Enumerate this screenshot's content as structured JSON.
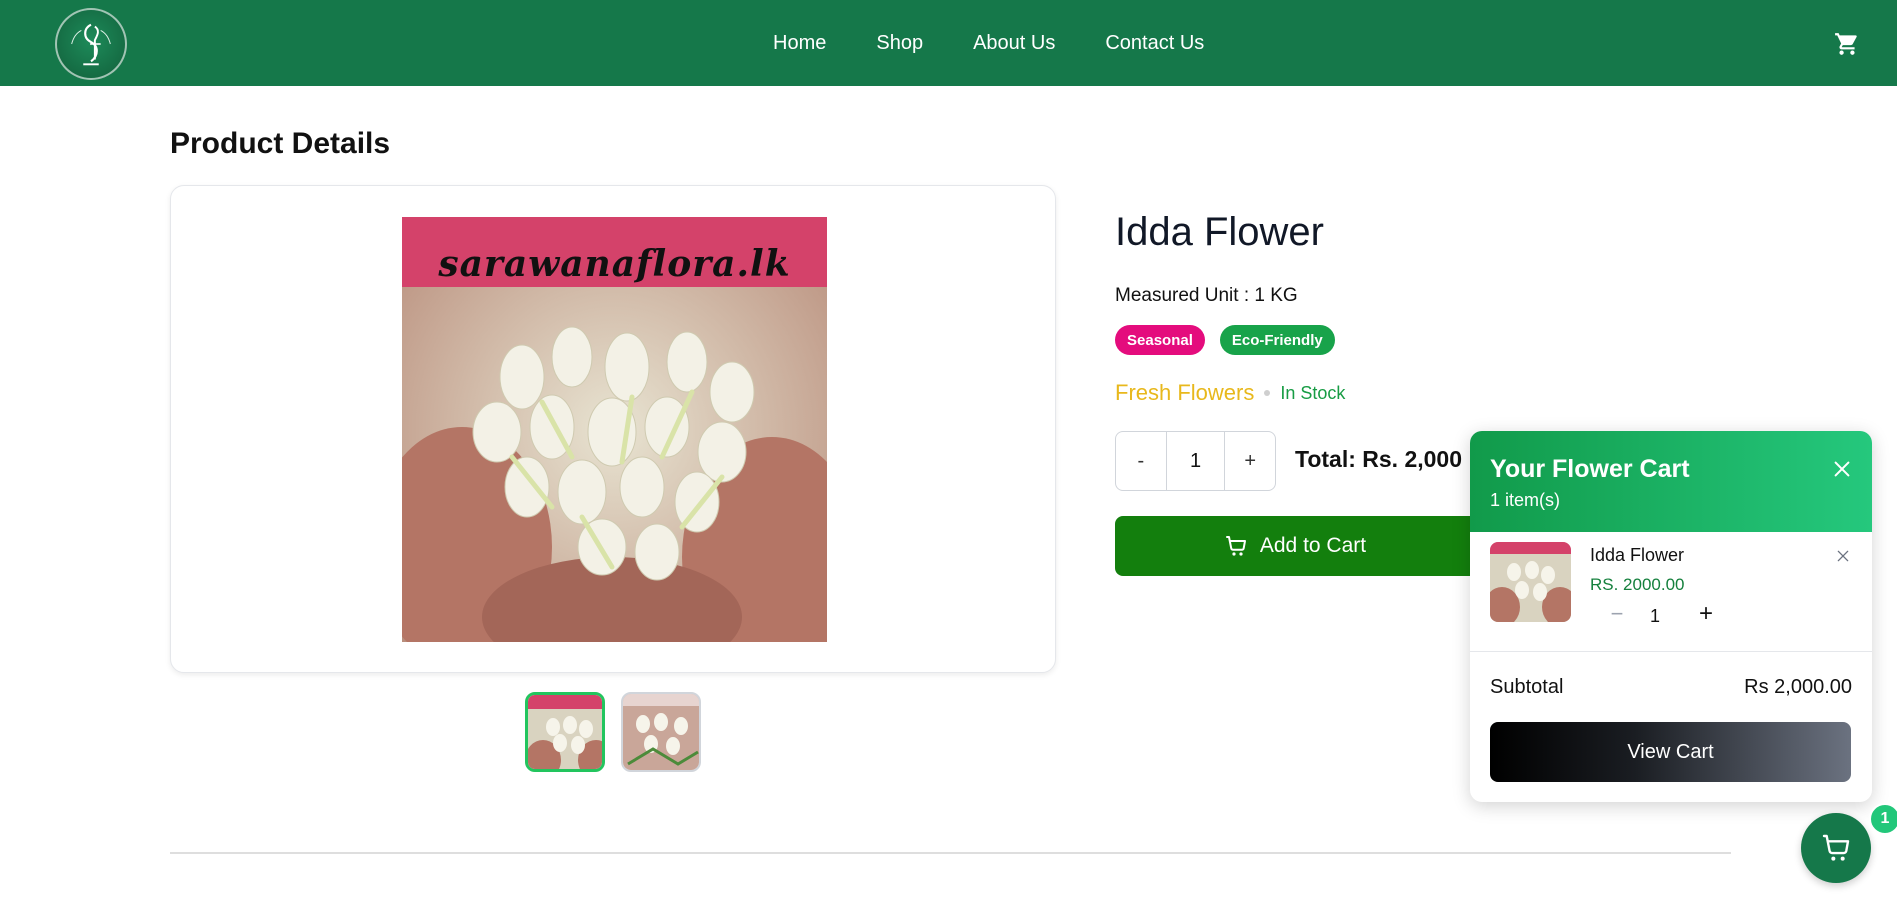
{
  "nav": {
    "items": [
      {
        "label": "Home"
      },
      {
        "label": "Shop"
      },
      {
        "label": "About Us"
      },
      {
        "label": "Contact Us"
      }
    ],
    "logo_icon": "sf-monogram-logo",
    "cart_icon": "cart-icon"
  },
  "page": {
    "title": "Product Details"
  },
  "product": {
    "name": "Idda Flower",
    "measured_unit": "Measured Unit : 1 KG",
    "tags": [
      {
        "label": "Seasonal",
        "color": "#e40c7d"
      },
      {
        "label": "Eco-Friendly",
        "color": "#18a34a"
      }
    ],
    "category": "Fresh Flowers",
    "stock": "In Stock",
    "image_watermark": "sarawanaflora.lk",
    "quantity": {
      "minus": "-",
      "value": "1",
      "plus": "+"
    },
    "total": "Total: Rs. 2,000",
    "add_to_cart": "Add to Cart"
  },
  "cart": {
    "title": "Your Flower Cart",
    "count": "1 item(s)",
    "items": [
      {
        "name": "Idda Flower",
        "price": "RS. 2000.00",
        "qty": "1"
      }
    ],
    "subtotal_label": "Subtotal",
    "subtotal_value": "Rs 2,000.00",
    "view_cart": "View Cart",
    "badge_count": "1"
  },
  "colors": {
    "header": "#15784a",
    "add_to_cart": "#137f0d",
    "category": "#e8b81c",
    "stock": "#179c44"
  }
}
